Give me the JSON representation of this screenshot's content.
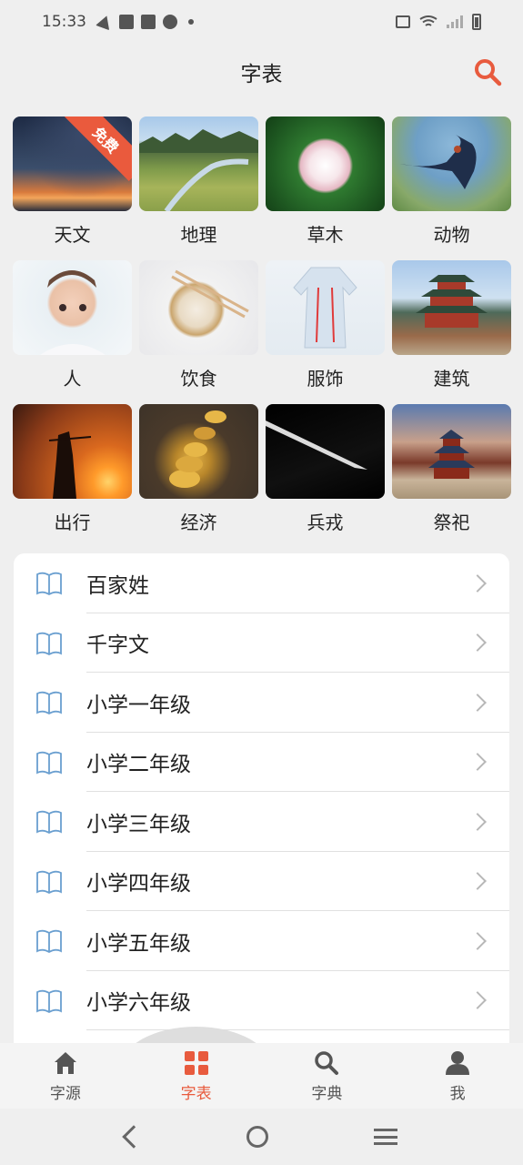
{
  "status_bar": {
    "time": "15:33"
  },
  "header": {
    "title": "字表",
    "search_icon": "search-icon",
    "accent": "#e85b3e"
  },
  "categories": [
    {
      "label": "天文",
      "badge": "免费"
    },
    {
      "label": "地理"
    },
    {
      "label": "草木"
    },
    {
      "label": "动物"
    },
    {
      "label": "人"
    },
    {
      "label": "饮食"
    },
    {
      "label": "服饰"
    },
    {
      "label": "建筑"
    },
    {
      "label": "出行"
    },
    {
      "label": "经济"
    },
    {
      "label": "兵戎"
    },
    {
      "label": "祭祀"
    }
  ],
  "list": {
    "icon": "book-icon",
    "items": [
      {
        "label": "百家姓"
      },
      {
        "label": "千字文"
      },
      {
        "label": "小学一年级"
      },
      {
        "label": "小学二年级"
      },
      {
        "label": "小学三年级"
      },
      {
        "label": "小学四年级"
      },
      {
        "label": "小学五年级"
      },
      {
        "label": "小学六年级"
      }
    ]
  },
  "bottom_nav": {
    "tabs": [
      {
        "label": "字源",
        "icon": "home-icon"
      },
      {
        "label": "字表",
        "icon": "grid-icon",
        "active": true
      },
      {
        "label": "字典",
        "icon": "search-icon"
      },
      {
        "label": "我",
        "icon": "user-icon"
      }
    ]
  }
}
